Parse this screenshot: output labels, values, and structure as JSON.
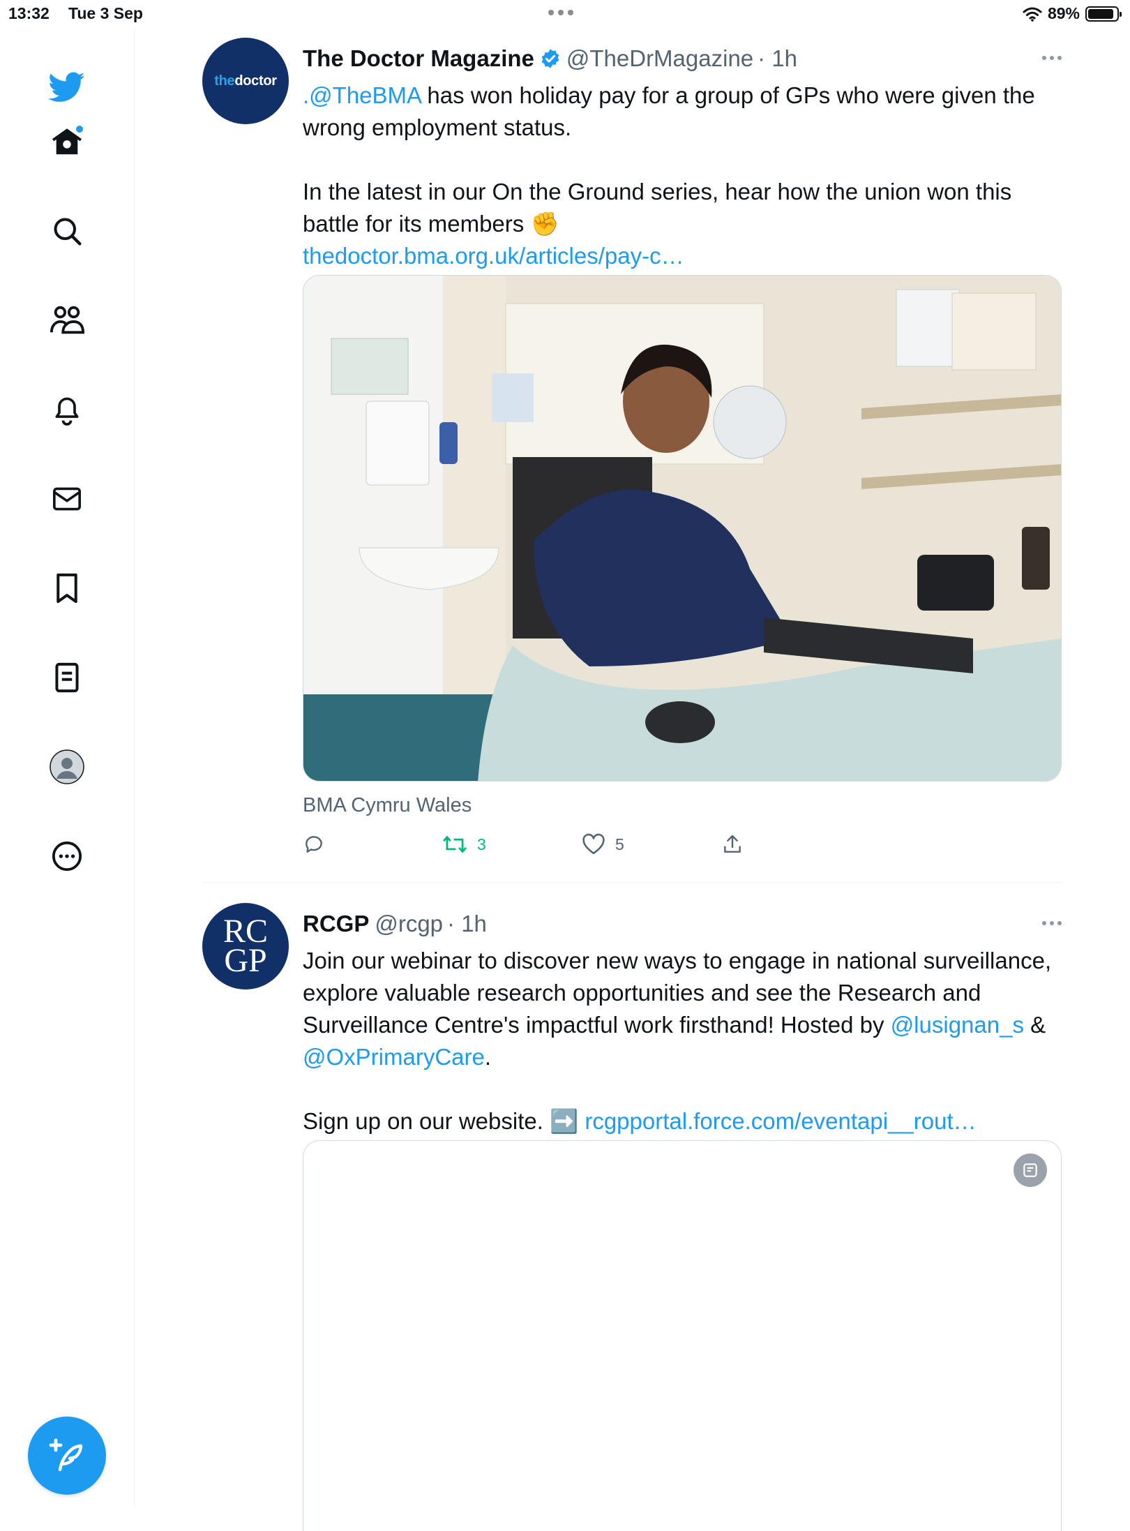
{
  "status_bar": {
    "time": "13:32",
    "date": "Tue 3 Sep",
    "battery_text": "89%",
    "battery_level": 0.89
  },
  "sidebar": {
    "items": [
      {
        "name": "home",
        "icon": "home-icon",
        "has_notification_dot": true
      },
      {
        "name": "explore",
        "icon": "search-icon"
      },
      {
        "name": "communities",
        "icon": "people-icon"
      },
      {
        "name": "notifications",
        "icon": "bell-icon"
      },
      {
        "name": "messages",
        "icon": "mail-icon"
      },
      {
        "name": "bookmarks",
        "icon": "bookmark-icon"
      },
      {
        "name": "lists",
        "icon": "list-icon"
      },
      {
        "name": "profile",
        "icon": "avatar-icon"
      },
      {
        "name": "more",
        "icon": "more-circle-icon"
      }
    ],
    "compose_icon": "feather-plus-icon",
    "accent": "#1d9bf0"
  },
  "tweets": [
    {
      "avatar_text_the": "the",
      "avatar_text_doctor": "doctor",
      "name": "The Doctor Magazine",
      "verified": true,
      "handle": "@TheDrMagazine",
      "time": "· 1h",
      "text_line1_mention": ".@TheBMA",
      "text_line1_rest": " has won holiday pay for a group of GPs who were given the wrong employment status.",
      "text_para2": "In the latest in our On the Ground series, hear how the union won this battle for its members ✊",
      "link": "thedoctor.bma.org.uk/articles/pay-c…",
      "media_caption": "BMA Cymru Wales",
      "retweets": "3",
      "likes": "5"
    },
    {
      "avatar_line1": "RC",
      "avatar_line2": "GP",
      "name": "RCGP",
      "handle": "@rcgp",
      "time": "· 1h",
      "text_a": "Join our webinar to discover new ways to engage in national surveillance, explore valuable research opportunities and see the Research and Surveillance Centre's impactful work firsthand! Hosted by ",
      "mention1": "@lusignan_s",
      "amp": " & ",
      "mention2": "@OxPrimaryCare",
      "period": ".",
      "signup_text": "Sign up on our website. ➡️ ",
      "signup_link": "rcgpportal.force.com/eventapi__rout…"
    }
  ]
}
